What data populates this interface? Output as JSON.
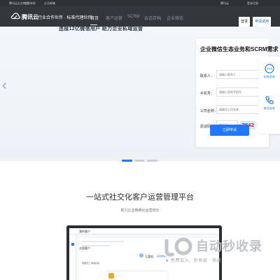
{
  "topbar": {
    "items": [
      "腾讯云企业微信",
      "立即体验",
      "企业邮箱"
    ],
    "right_items": [
      "腾讯云",
      "登录注册"
    ]
  },
  "nav": {
    "logo_text": "腾讯云",
    "slogan": "行业合作伙伴 · 标准代理伙伴",
    "items": [
      "首页",
      "客户运营",
      "SCRM",
      "会话存档",
      "企业微信"
    ],
    "active_index": 0,
    "login_label": "登录",
    "trial_label": "申请试用"
  },
  "hero": {
    "partial_heading": "连接12亿微信用户 助力企业私域运营",
    "form": {
      "title": "企业微信生态业务和SCRM需求",
      "fields": [
        {
          "label": "联系人：",
          "placeholder": "请输入联系人"
        },
        {
          "label": "手机号：",
          "placeholder": "请输入您的手机号"
        },
        {
          "label": "公司名称：",
          "placeholder": "请填写公司名称"
        },
        {
          "label": "验证码",
          "placeholder": "验证码"
        }
      ],
      "captcha_text": "7642",
      "submit_label": "立即申请"
    },
    "slide_count": 3,
    "active_slide": 0
  },
  "side_panel": {
    "items": [
      {
        "label": "在线咨询",
        "icon": "chat-icon"
      },
      {
        "label": "电话咨询",
        "icon": "phone-icon"
      }
    ]
  },
  "section": {
    "title": "一站式社交化客户运营管理平台",
    "subtitle": "助力企业精细化运营增长"
  },
  "mockup": {
    "top_label": "我的客户",
    "table_head": "全部客户",
    "customer_name": "王喜阳",
    "customer_tag": "来自微信 ✓",
    "left_text": "所属员工  添加时间"
  },
  "watermark": {
    "text": "自动秒收录",
    "sub": "★ 免费加入 · 秒收录 · 快速"
  }
}
